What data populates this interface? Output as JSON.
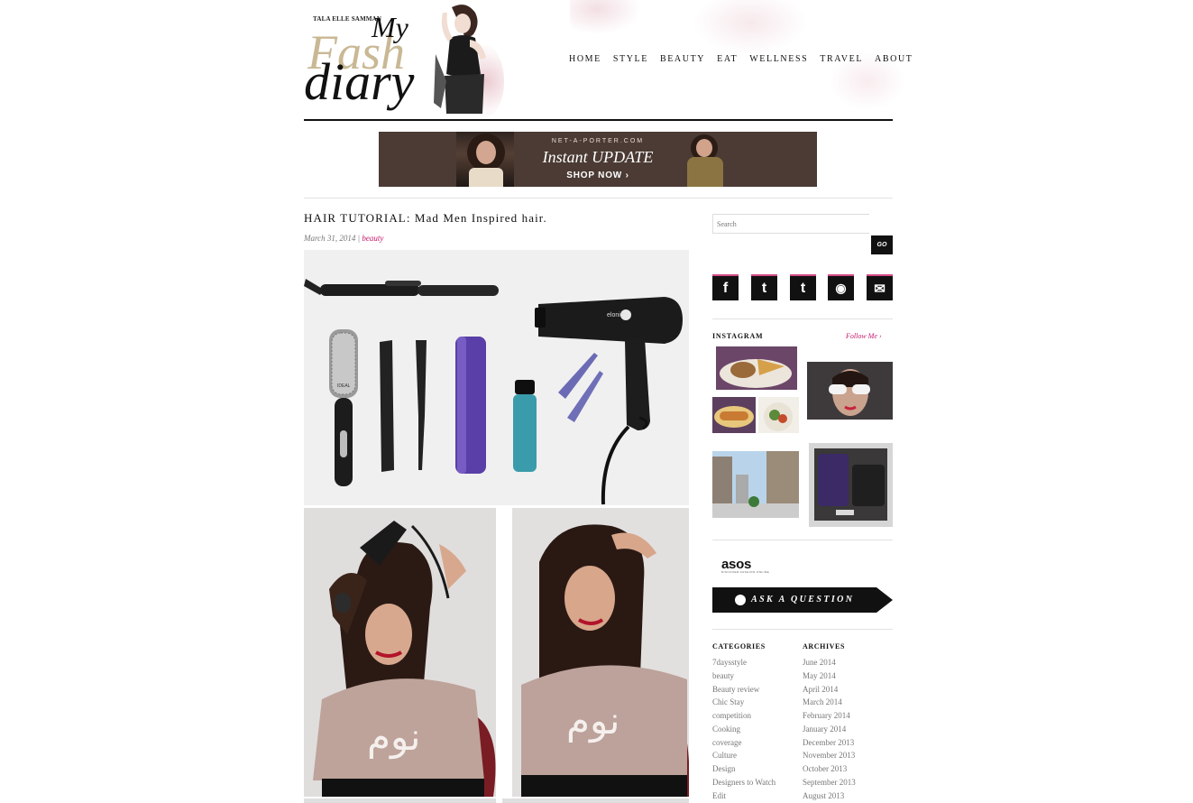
{
  "logo": {
    "author": "TALA ELLE SAMMAN",
    "word1": "My",
    "word2": "Fash",
    "word3": "diary"
  },
  "nav": [
    "HOME",
    "STYLE",
    "BEAUTY",
    "EAT",
    "WELLNESS",
    "TRAVEL",
    "ABOUT"
  ],
  "banner": {
    "site": "NET-A-PORTER.COM",
    "headline": "Instant UPDATE",
    "cta": "SHOP NOW ›"
  },
  "post": {
    "title": "HAIR TUTORIAL: Mad Men Inspired hair.",
    "date": "March 31, 2014",
    "separator": " | ",
    "category": "beauty"
  },
  "sidebar": {
    "search_placeholder": "Search",
    "go_label": "GO",
    "socials": [
      {
        "icon": "facebook-icon",
        "glyph": "f"
      },
      {
        "icon": "twitter-icon",
        "glyph": "t"
      },
      {
        "icon": "tumblr-icon",
        "glyph": "t"
      },
      {
        "icon": "rss-icon",
        "glyph": "◉"
      },
      {
        "icon": "email-icon",
        "glyph": "✉"
      }
    ],
    "instagram_title": "INSTAGRAM",
    "instagram_follow": "Follow Me ›",
    "asos_logo": "asos",
    "asos_tag": "DISCOVER FASHION ONLINE",
    "ask_label": "ASK A QUESTION",
    "categories_title": "CATEGORIES",
    "categories": [
      "7daysstyle",
      "beauty",
      "Beauty review",
      "Chic Stay",
      "competition",
      "Cooking",
      "coverage",
      "Culture",
      "Design",
      "Designers to Watch",
      "Edit"
    ],
    "archives_title": "ARCHIVES",
    "archives": [
      "June 2014",
      "May 2014",
      "April 2014",
      "March 2014",
      "February 2014",
      "January 2014",
      "December 2013",
      "November 2013",
      "October 2013",
      "September 2013",
      "August 2013"
    ]
  },
  "photos": {
    "dryer_brand": "elonic",
    "brush_brand": "IDEAL",
    "sweater_text": "نوم"
  },
  "colors": {
    "accent_pink": "#c4166a",
    "social_bar": "#d34b87",
    "dark": "#111111",
    "banner_bg": "#4b3b34"
  }
}
